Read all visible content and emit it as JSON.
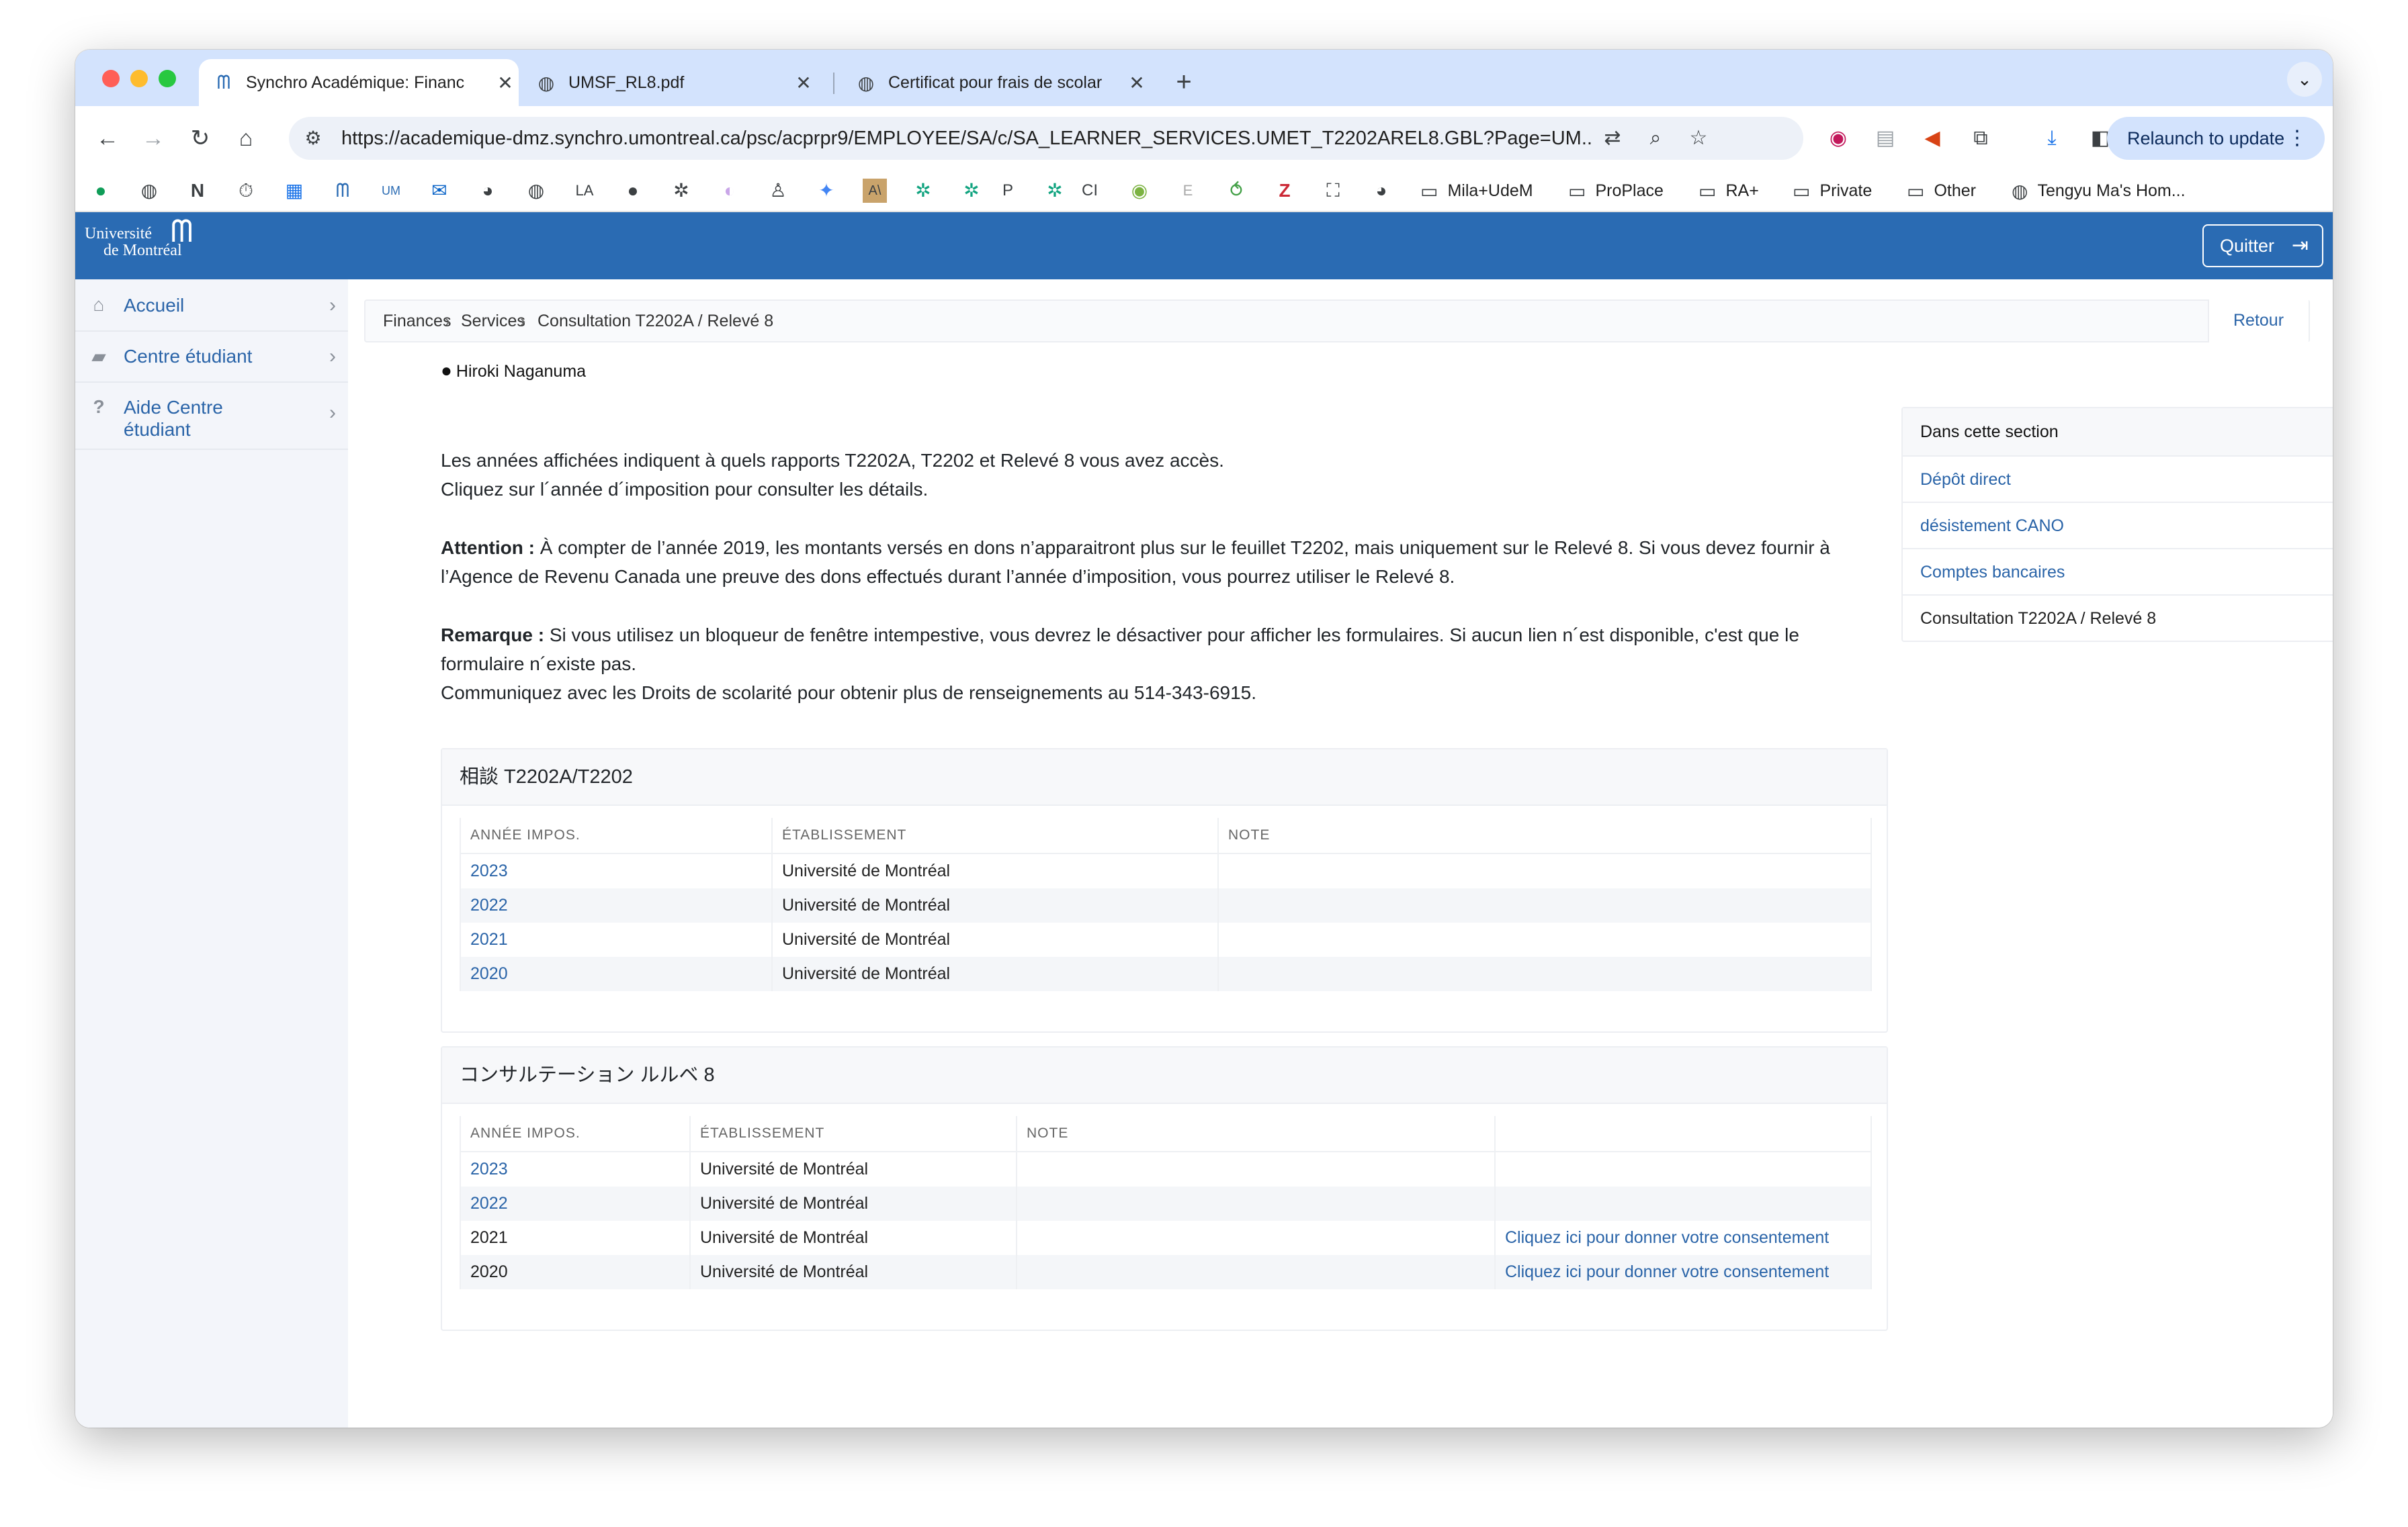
{
  "browser": {
    "tabs": [
      {
        "title": "Synchro Académique: Financ",
        "icon": "udem-icon",
        "active": true
      },
      {
        "title": "UMSF_RL8.pdf",
        "icon": "globe-icon",
        "active": false
      },
      {
        "title": "Certificat pour frais de scolar",
        "icon": "globe-icon",
        "active": false
      }
    ],
    "url": "https://academique-dmz.synchro.umontreal.ca/psc/acprpr9/EMPLOYEE/SA/c/SA_LEARNER_SERVICES.UMET_T2202AREL8.GBL?Page=UM...",
    "relaunch_label": "Relaunch to update",
    "bookmarks": {
      "icon_labels": {
        "p": "P",
        "ci": "CI",
        "e": "E"
      },
      "folders": [
        "Mila+UdeM",
        "ProPlace",
        "RA+",
        "Private",
        "Other"
      ],
      "last": "Tengyu Ma's Hom..."
    }
  },
  "site": {
    "logo_line1": "Université",
    "logo_line2": "de Montréal",
    "quit_label": "Quitter"
  },
  "sidebar": {
    "items": [
      {
        "label": "Accueil",
        "icon": "home-icon"
      },
      {
        "label": "Centre étudiant",
        "icon": "book-icon"
      },
      {
        "label": "Aide Centre étudiant",
        "icon": "question-icon"
      }
    ]
  },
  "breadcrumb": {
    "items": [
      "Finances",
      "Services",
      "Consultation T2202A / Relevé 8"
    ],
    "back_label": "Retour"
  },
  "user": {
    "name": "Hiroki Naganuma"
  },
  "intro": {
    "line1": "Les années affichées indiquent à quels rapports T2202A, T2202 et Relevé 8 vous avez accès.",
    "line2": "Cliquez sur l´année d´imposition pour consulter les détails.",
    "attention_label": "Attention :",
    "attention_text": " À compter de l’année 2019, les montants versés en dons n’apparaitront plus sur le feuillet T2202, mais uniquement sur le Relevé 8. Si vous devez fournir à l’Agence de Revenu Canada une preuve des dons effectués durant l’année d’imposition, vous pourrez utiliser le Relevé 8.",
    "remarque_label": "Remarque :",
    "remarque_text": " Si vous utilisez un bloqueur de fenêtre intempestive, vous devrez le désactiver pour afficher les formulaires. Si aucun lien n´est disponible, c'est que le formulaire n´existe pas.",
    "contact": "Communiquez avec les Droits de scolarité pour obtenir plus de renseignements au 514-343-6915."
  },
  "section_panel": {
    "title": "Dans cette section",
    "items": [
      "Dépôt direct",
      "désistement CANO",
      "Comptes bancaires",
      "Consultation T2202A / Relevé 8"
    ]
  },
  "t2202": {
    "title": "相談 T2202A/T2202",
    "headers": [
      "ANNÉE IMPOS.",
      "ÉTABLISSEMENT",
      "NOTE"
    ],
    "rows": [
      {
        "year": "2023",
        "inst": "Université de Montréal",
        "note": ""
      },
      {
        "year": "2022",
        "inst": "Université de Montréal",
        "note": ""
      },
      {
        "year": "2021",
        "inst": "Université de Montréal",
        "note": ""
      },
      {
        "year": "2020",
        "inst": "Université de Montréal",
        "note": ""
      }
    ]
  },
  "releve8": {
    "title": "コンサルテーション ルルベ 8",
    "headers": [
      "ANNÉE IMPOS.",
      "ÉTABLISSEMENT",
      "NOTE",
      ""
    ],
    "rows": [
      {
        "year": "2023",
        "inst": "Université de Montréal",
        "note": "",
        "consent": ""
      },
      {
        "year": "2022",
        "inst": "Université de Montréal",
        "note": "",
        "consent": ""
      },
      {
        "year": "2021",
        "inst": "Université de Montréal",
        "note": "",
        "consent": "Cliquez ici pour donner votre consentement"
      },
      {
        "year": "2020",
        "inst": "Université de Montréal",
        "note": "",
        "consent": "Cliquez ici pour donner votre consentement"
      }
    ]
  },
  "colors": {
    "brand": "#2a6bb3",
    "link": "#2a64a8"
  }
}
